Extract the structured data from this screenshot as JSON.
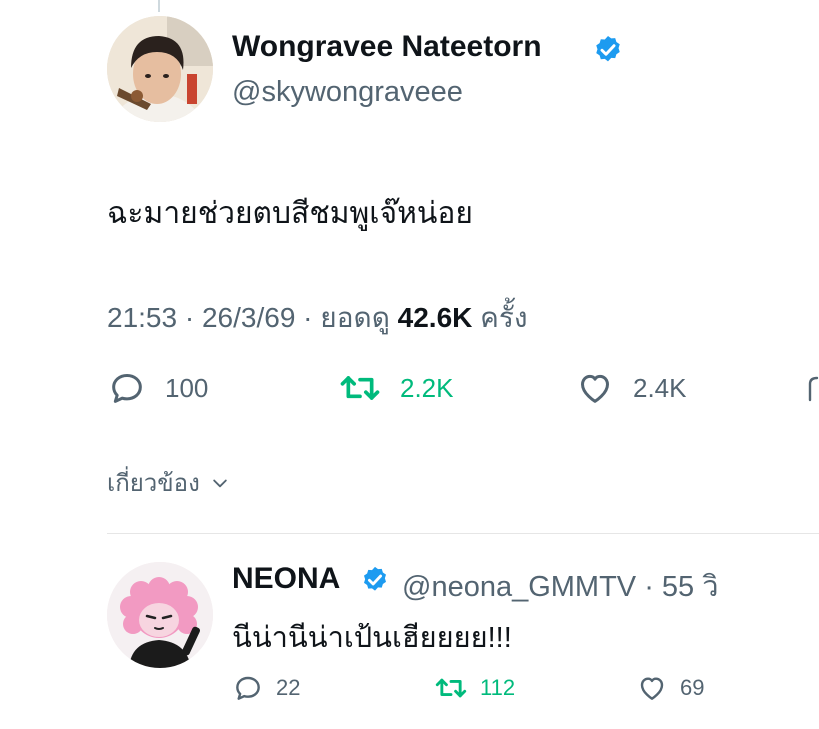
{
  "tweet": {
    "display_name": "Wongravee Nateetorn",
    "handle": "@skywongraveee",
    "text": "ฉะมายช่วยตบสีชมพูเจ๊หน่อย",
    "time": "21:53",
    "date": "26/3/69",
    "views_label": "ยอดดู",
    "views_count": "42.6K",
    "views_suffix": "ครั้ง",
    "replies": "100",
    "retweets": "2.2K",
    "likes": "2.4K"
  },
  "related": {
    "label": "เกี่ยวข้อง"
  },
  "reply": {
    "display_name": "NEONA",
    "handle": "@neona_GMMTV",
    "time_ago": "55 วิ",
    "text": "นีน่านีน่าเป้นเฮียยยย!!!",
    "replies": "22",
    "retweets": "112",
    "likes": "69"
  },
  "colors": {
    "verified": "#1d9bf0",
    "retweet": "#00ba7c",
    "secondary_text": "#536471",
    "primary_text": "#0f1419"
  },
  "icons": [
    "verified-icon",
    "reply-icon",
    "retweet-icon",
    "like-icon",
    "chevron-down-icon"
  ]
}
